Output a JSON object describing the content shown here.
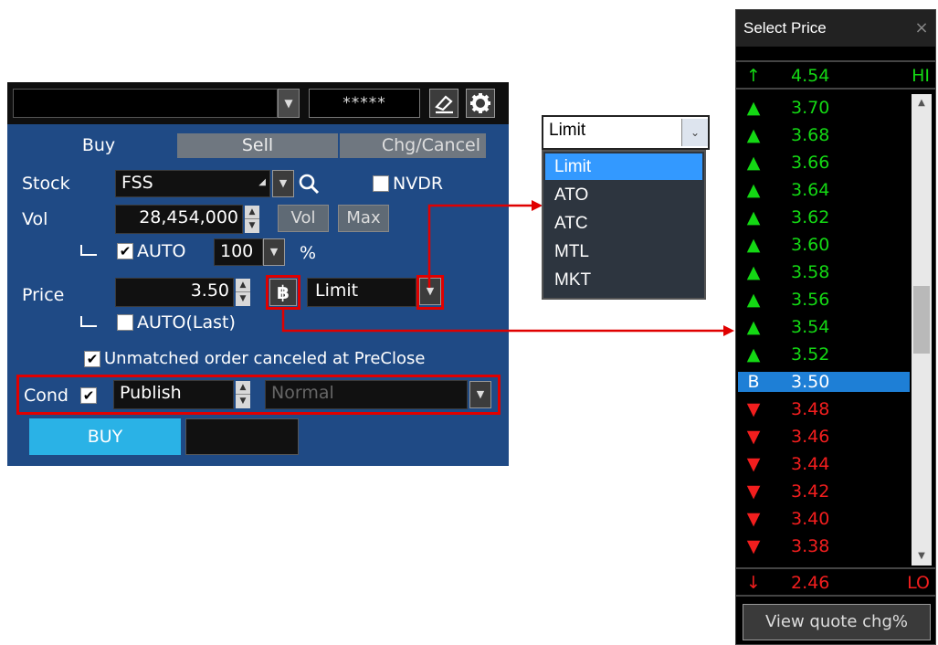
{
  "panel": {
    "password_mask": "*****",
    "tabs": {
      "buy": "Buy",
      "sell": "Sell",
      "chg": "Chg/Cancel"
    },
    "stock_label": "Stock",
    "stock_value": "FSS",
    "nvdr_label": "NVDR",
    "vol_label": "Vol",
    "vol_value": "28,454,000",
    "vol_btn": "Vol",
    "max_btn": "Max",
    "auto_label": "AUTO",
    "auto_pct_value": "100",
    "pct_sign": "%",
    "price_label": "Price",
    "price_value": "3.50",
    "price_type": "Limit",
    "auto_last_label": "AUTO(Last)",
    "unmatched_label": "Unmatched order canceled at PreClose",
    "cond_label": "Cond",
    "cond_value": "Publish",
    "cond_mode": "Normal",
    "buy_btn": "BUY",
    "baht_symbol": "฿"
  },
  "order_type_dropdown": {
    "current": "Limit",
    "options": [
      "Limit",
      "ATO",
      "ATC",
      "MTL",
      "MKT"
    ],
    "selected_index": 0
  },
  "price_window": {
    "title": "Select Price",
    "close_glyph": "×",
    "hi": {
      "arrow": "↑",
      "value": "4.54",
      "tag": "HI"
    },
    "lo": {
      "arrow": "↓",
      "value": "2.46",
      "tag": "LO"
    },
    "rows": [
      {
        "marker": "▲",
        "value": "3.70",
        "dir": "up"
      },
      {
        "marker": "▲",
        "value": "3.68",
        "dir": "up"
      },
      {
        "marker": "▲",
        "value": "3.66",
        "dir": "up"
      },
      {
        "marker": "▲",
        "value": "3.64",
        "dir": "up"
      },
      {
        "marker": "▲",
        "value": "3.62",
        "dir": "up"
      },
      {
        "marker": "▲",
        "value": "3.60",
        "dir": "up"
      },
      {
        "marker": "▲",
        "value": "3.58",
        "dir": "up"
      },
      {
        "marker": "▲",
        "value": "3.56",
        "dir": "up"
      },
      {
        "marker": "▲",
        "value": "3.54",
        "dir": "up"
      },
      {
        "marker": "▲",
        "value": "3.52",
        "dir": "up"
      },
      {
        "marker": "B",
        "value": "3.50",
        "dir": "sel"
      },
      {
        "marker": "▼",
        "value": "3.48",
        "dir": "down"
      },
      {
        "marker": "▼",
        "value": "3.46",
        "dir": "down"
      },
      {
        "marker": "▼",
        "value": "3.44",
        "dir": "down"
      },
      {
        "marker": "▼",
        "value": "3.42",
        "dir": "down"
      },
      {
        "marker": "▼",
        "value": "3.40",
        "dir": "down"
      },
      {
        "marker": "▼",
        "value": "3.38",
        "dir": "down"
      }
    ],
    "view_btn": "View quote chg%"
  },
  "colors": {
    "panel_bg": "#1f4a85",
    "up": "#14d814",
    "down": "#f21e1e",
    "selected": "#1e7fd6",
    "buy": "#2ab2e6",
    "highlight": "#e00000"
  }
}
